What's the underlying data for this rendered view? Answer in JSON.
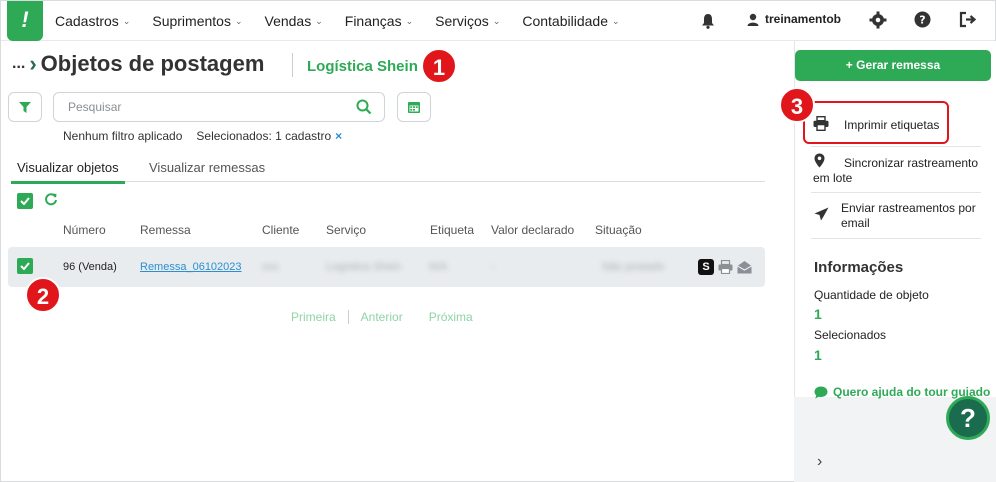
{
  "nav": {
    "logo": "!",
    "items": [
      "Cadastros",
      "Suprimentos",
      "Vendas",
      "Finanças",
      "Serviços",
      "Contabilidade"
    ],
    "user": "treinamentob"
  },
  "header": {
    "breadcrumb_dots": "...",
    "title": "Objetos de postagem",
    "subtitle": "Logística Shein"
  },
  "annotations": [
    "1",
    "2",
    "3"
  ],
  "search": {
    "placeholder": "Pesquisar"
  },
  "filters": {
    "none_applied": "Nenhum filtro aplicado",
    "selected": "Selecionados: 1 cadastro",
    "clear": "×"
  },
  "tabs": [
    "Visualizar objetos",
    "Visualizar remessas"
  ],
  "table": {
    "columns": [
      "Número",
      "Remessa",
      "Cliente",
      "Serviço",
      "Etiqueta",
      "Valor declarado",
      "Situação"
    ],
    "rows": [
      {
        "numero": "96 (Venda)",
        "remessa": "Remessa_06102023",
        "cliente": "xxx",
        "servico": "Logística Shein",
        "etiqueta": "N/A",
        "valor": "-",
        "situacao": "Não postado",
        "s_badge": "S"
      }
    ]
  },
  "pager": [
    "Primeira",
    "Anterior",
    "Próxima"
  ],
  "sidebar": {
    "generate": "+ Gerar remessa",
    "actions": {
      "print": "Imprimir etiquetas",
      "sync_1": "Sincronizar rastreamento",
      "sync_2": "em lote",
      "send_1": "Enviar rastreamentos por",
      "send_2": "email"
    },
    "info_title": "Informações",
    "qty_label": "Quantidade de objeto",
    "qty_value": "1",
    "sel_label": "Selecionados",
    "sel_value": "1",
    "tour": "Quero ajuda do tour guiado",
    "help": "?"
  },
  "colors": {
    "accent": "#2eaa57",
    "annotation": "#e0161b",
    "link": "#2b8fd1"
  }
}
